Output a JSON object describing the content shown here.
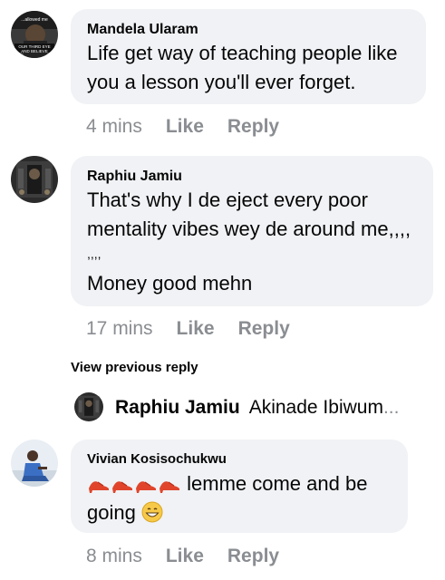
{
  "comments": [
    {
      "author": "Mandela Ularam",
      "lines": [
        "Life get way of teaching people like",
        "you a lesson you'll ever forget."
      ],
      "time": "4 mins",
      "like": "Like",
      "reply": "Reply"
    },
    {
      "author": "Raphiu Jamiu",
      "lines": [
        "That's why I de eject every poor",
        "mentality vibes wey de around me,,,,",
        ",,,,",
        "Money good mehn"
      ],
      "time": "17 mins",
      "like": "Like",
      "reply": "Reply"
    },
    {
      "author": "Vivian Kosisochukwu",
      "line1_text": "lemme come and be",
      "line2_text": "going",
      "time": "8 mins",
      "like": "Like",
      "reply": "Reply"
    }
  ],
  "view_previous": "View previous reply",
  "reply_preview": {
    "author": "Raphiu Jamiu",
    "text": "Akinade Ibiwum",
    "ellipsis": "..."
  },
  "avatar_texts": {
    "mandela_line1": "...allowed me",
    "mandela_line2": "OUR THIRD EYE",
    "mandela_line3": "AND BELIEVE"
  },
  "icons": {
    "shoe": "high-heel-shoe-icon",
    "grin": "grinning-face-icon"
  },
  "colors": {
    "bubble": "#f0f2f5",
    "meta": "#8a8d91",
    "text": "#050505"
  }
}
